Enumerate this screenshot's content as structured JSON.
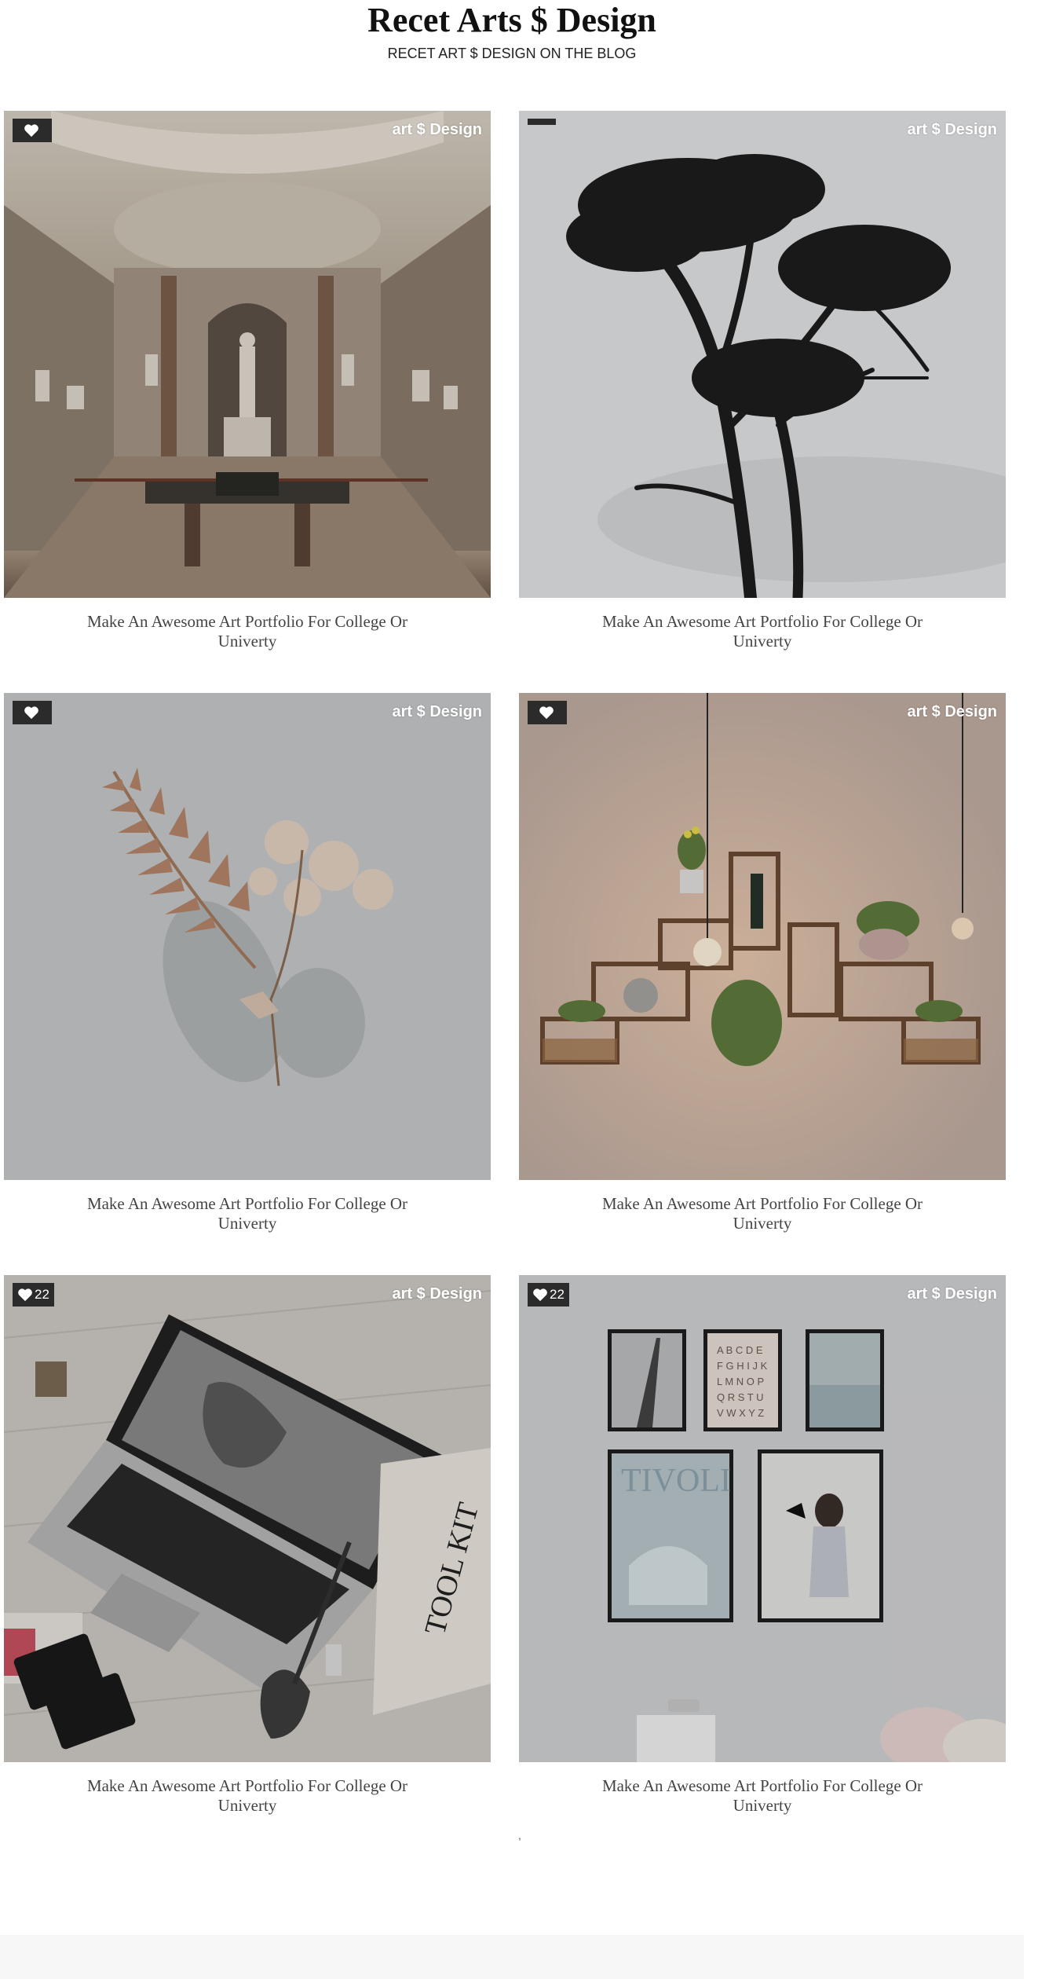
{
  "header": {
    "title": "Recet Arts $ Design",
    "subtitle": "RECET ART $ DESIGN ON THE BLOG"
  },
  "posts": [
    {
      "category": "art $ Design",
      "title": "Make An Awesome Art Portfolio For College Or Univerty",
      "likes": "",
      "icon": "heart-icon"
    },
    {
      "category": "art $ Design",
      "title": "Make An Awesome Art Portfolio For College Or Univerty",
      "likes": "",
      "icon": "heart-icon"
    },
    {
      "category": "art $ Design",
      "title": "Make An Awesome Art Portfolio For College Or Univerty",
      "likes": "",
      "icon": "heart-icon"
    },
    {
      "category": "art $ Design",
      "title": "Make An Awesome Art Portfolio For College Or Univerty",
      "likes": "",
      "icon": "heart-icon"
    },
    {
      "category": "art $ Design",
      "title": "Make An Awesome Art Portfolio For College Or Univerty",
      "likes": "22",
      "icon": "heart-icon"
    },
    {
      "category": "art $ Design",
      "title": "Make An Awesome Art Portfolio For College Or Univerty",
      "likes": "22",
      "icon": "heart-icon"
    }
  ],
  "stray_mark": ",",
  "colors": {
    "badge": "#2b2b2b",
    "tag_text": "#ffffff",
    "footer": "#f7f7f7"
  }
}
